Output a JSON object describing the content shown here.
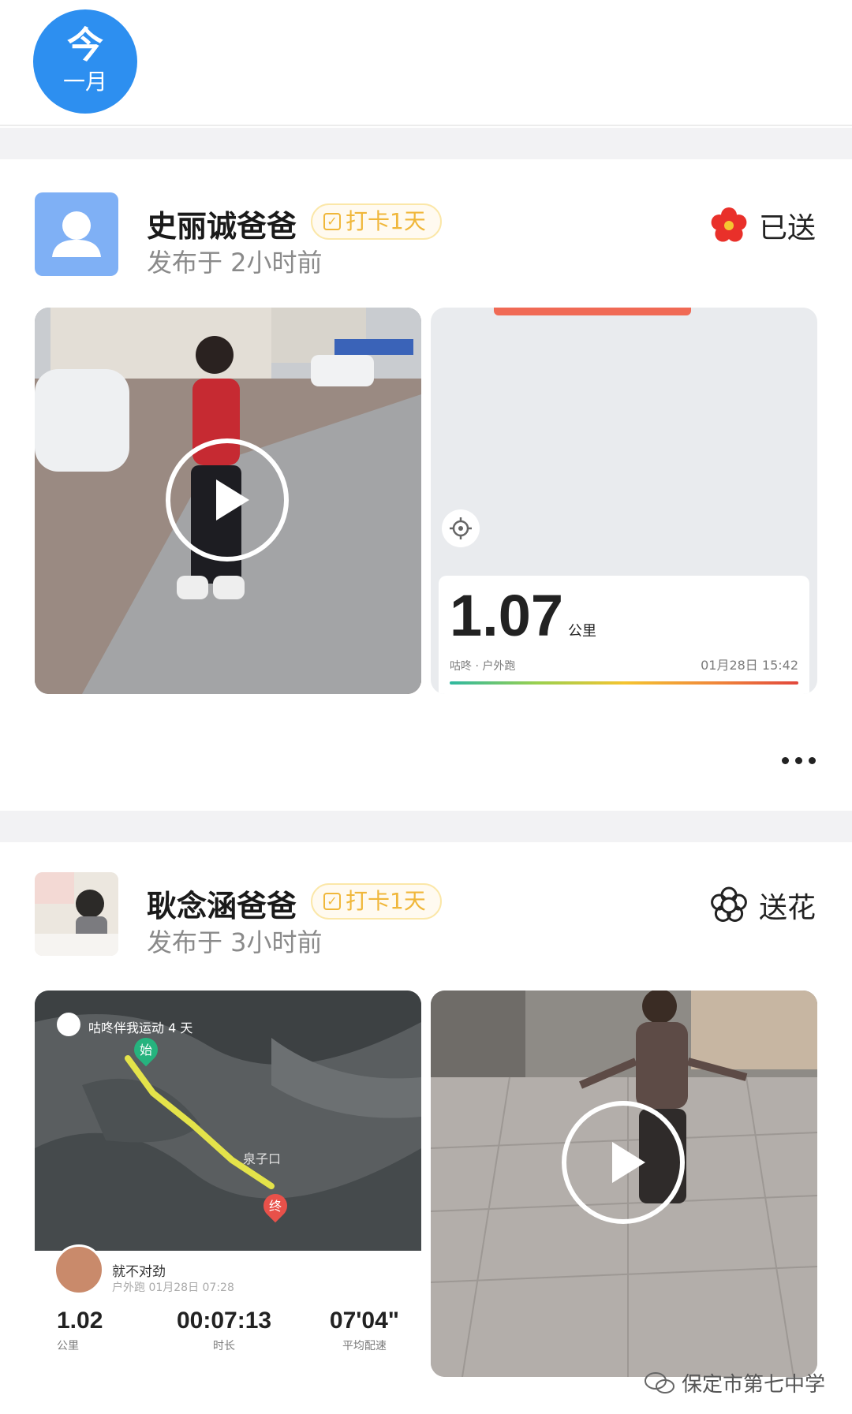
{
  "date_badge": {
    "day": "今",
    "month": "一月",
    "color": "#2d8ff0"
  },
  "posts": [
    {
      "author": "史丽诚爸爸",
      "badge": "打卡1天",
      "posted": "发布于 2小时前",
      "flower_label": "已送",
      "flower_state": "sent",
      "flower_color": "#e9302a",
      "run_card": {
        "distance": "1.07",
        "unit": "公里",
        "source": "咕咚 · 户外跑",
        "datetime": "01月28日 15:42"
      },
      "video_icon": "play-icon",
      "likes": "0",
      "comments": "0"
    },
    {
      "author": "耿念涵爸爸",
      "badge": "打卡1天",
      "posted": "发布于 3小时前",
      "flower_label": "送花",
      "flower_state": "not-sent",
      "map_card": {
        "app_label": "咕咚伴我运动 4 天",
        "start_marker": "始",
        "end_marker": "终",
        "place": "泉子口",
        "user": "就不对劲",
        "subtitle": "户外跑 01月28日 07:28",
        "stats": [
          {
            "value": "1.02",
            "label": "公里"
          },
          {
            "value": "00:07:13",
            "label": "时长"
          },
          {
            "value": "07'04\"",
            "label": "平均配速"
          }
        ]
      },
      "video_icon": "play-icon"
    }
  ],
  "watermark": "保定市第七中学"
}
